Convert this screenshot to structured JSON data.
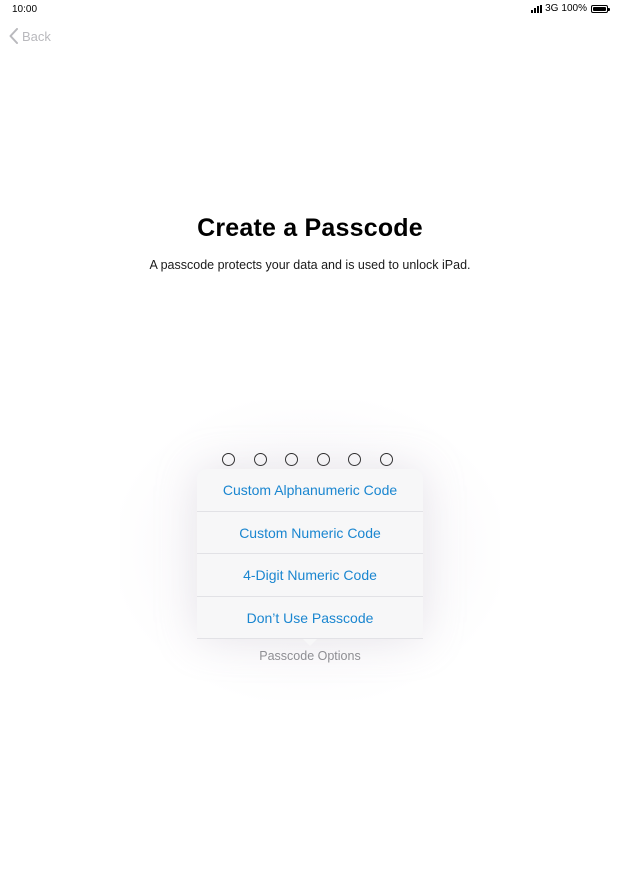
{
  "status_bar": {
    "time": "10:00",
    "network": "3G",
    "battery": "100%"
  },
  "nav": {
    "back_label": "Back"
  },
  "main": {
    "title": "Create a Passcode",
    "subtitle": "A passcode protects your data and is used to unlock iPad.",
    "passcode_length": 6
  },
  "popover": {
    "items": [
      {
        "label": "Custom Alphanumeric Code"
      },
      {
        "label": "Custom Numeric Code"
      },
      {
        "label": "4-Digit Numeric Code"
      },
      {
        "label": "Don’t Use Passcode"
      }
    ]
  },
  "options_link": "Passcode Options",
  "colors": {
    "accent": "#1a86d0",
    "back": "#b9b9bd",
    "secondary_text": "#8e8e93"
  }
}
